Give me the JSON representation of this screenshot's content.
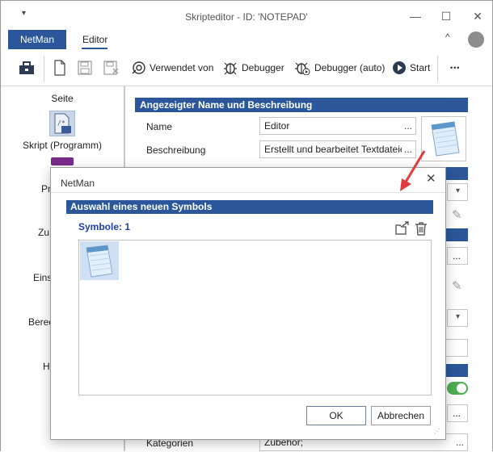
{
  "window": {
    "title": "Skripteditor - ID: 'NOTEPAD'",
    "qat_glyph": "▾",
    "min_glyph": "—",
    "max_glyph": "☐",
    "close_glyph": "✕"
  },
  "ribbon": {
    "tabs": [
      {
        "label": "NetMan",
        "active": false
      },
      {
        "label": "Editor",
        "active": true
      }
    ],
    "collapse_glyph": "^",
    "accent": "#2b579a"
  },
  "toolbar": {
    "used_by_label": "Verwendet von",
    "debugger_label": "Debugger",
    "debugger_auto_label": "Debugger (auto)",
    "start_label": "Start",
    "more_glyph": "•••"
  },
  "leftnav": {
    "header": "Seite",
    "current_label": "Skript (Programm)",
    "partial_items": [
      "Pr",
      "Zu",
      "Eins",
      "Bered",
      "H"
    ]
  },
  "main": {
    "section_title": "Angezeigter Name und Beschreibung",
    "name_label": "Name",
    "name_value": "Editor",
    "description_label": "Beschreibung",
    "description_value": "Erstellt und bearbeitet Textdateien",
    "ellipsis": "...",
    "categories_label": "Kategorien",
    "categories_value": "Zubehör;",
    "dropdown_glyph": "▾",
    "pencil_glyph": "✎"
  },
  "dialog": {
    "title": "NetMan",
    "close_glyph": "✕",
    "section_title": "Auswahl eines neuen Symbols",
    "count_label": "Symbole: 1",
    "ok_label": "OK",
    "cancel_label": "Abbrechen",
    "grip_glyph": "⋰"
  },
  "colors": {
    "accent": "#2b579a",
    "annotation_arrow": "#e03c3c",
    "toggle_green": "#4caf50"
  }
}
